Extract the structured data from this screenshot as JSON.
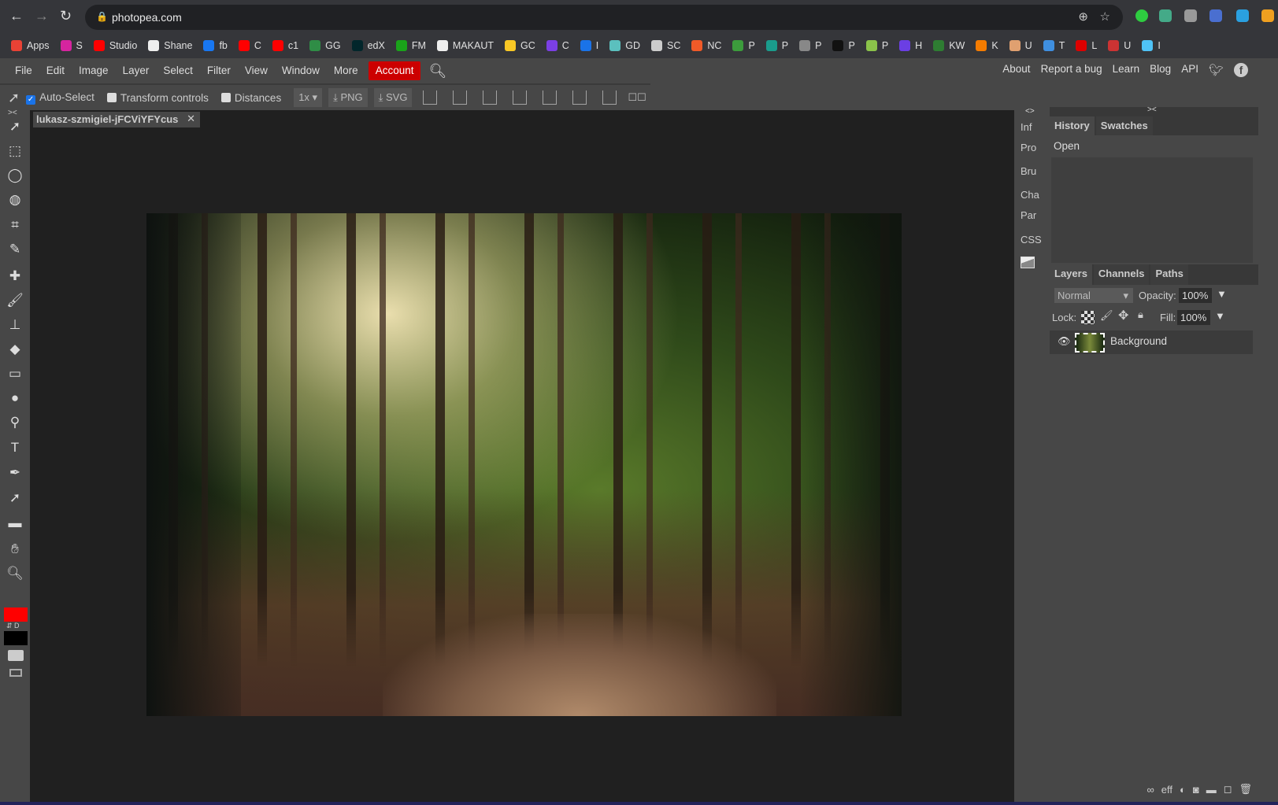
{
  "browser": {
    "url": "photopea.com"
  },
  "bookmarks": [
    "Apps",
    "S",
    "Studio",
    "Shane",
    "fb",
    "C",
    "c1",
    "GG",
    "edX",
    "FM",
    "MAKAUT",
    "GC",
    "C",
    "I",
    "GD",
    "SC",
    "NC",
    "P",
    "P",
    "P",
    "P",
    "P",
    "H",
    "KW",
    "K",
    "U",
    "T",
    "L",
    "U",
    "I"
  ],
  "bookmark_colors": [
    "#e94235",
    "#d6249f",
    "#ff0000",
    "#eee",
    "#1877f2",
    "#ff0000",
    "#ff0000",
    "#2f8d46",
    "#02262b",
    "#1aa31a",
    "#eee",
    "#f9c825",
    "#7b3fe4",
    "#1a73e8",
    "#5bc0be",
    "#ccc",
    "#f05a28",
    "#3c9c3c",
    "#1a9c8c",
    "#888",
    "#111",
    "#8bc34a",
    "#6b3fe4",
    "#2e7d32",
    "#f57c00",
    "#e0a070",
    "#3f8fe0",
    "#d00",
    "#c33",
    "#4fc3f7"
  ],
  "menu": {
    "items": [
      "File",
      "Edit",
      "Image",
      "Layer",
      "Select",
      "Filter",
      "View",
      "Window",
      "More"
    ],
    "account": "Account",
    "right": [
      "About",
      "Report a bug",
      "Learn",
      "Blog",
      "API"
    ]
  },
  "toolbar": {
    "auto_select": "Auto-Select",
    "auto_select_checked": true,
    "transform_controls": "Transform controls",
    "distances": "Distances",
    "scale": "1x",
    "png": "PNG",
    "svg": "SVG"
  },
  "document": {
    "tab": "lukasz-szmigiel-jFCViYFYcus"
  },
  "tools": [
    "move",
    "rect-select",
    "lasso",
    "quick-select",
    "crop",
    "eyedropper",
    "healing",
    "brush",
    "stamp",
    "eraser",
    "gradient",
    "blur",
    "dodge",
    "type",
    "pen",
    "path-select",
    "rectangle",
    "hand",
    "zoom"
  ],
  "colors": {
    "foreground": "#ff0000",
    "background": "#000000"
  },
  "mini_panel": [
    "Inf",
    "Pro",
    "Bru",
    "Cha",
    "Par",
    "CSS"
  ],
  "history": {
    "tabs": [
      "History",
      "Swatches"
    ],
    "items": [
      "Open"
    ]
  },
  "layers": {
    "tabs": [
      "Layers",
      "Channels",
      "Paths"
    ],
    "blend": "Normal",
    "opacity_label": "Opacity:",
    "opacity": "100%",
    "lock_label": "Lock:",
    "fill_label": "Fill:",
    "fill": "100%",
    "items": [
      {
        "name": "Background",
        "visible": true
      }
    ],
    "footer_eff": "eff"
  }
}
